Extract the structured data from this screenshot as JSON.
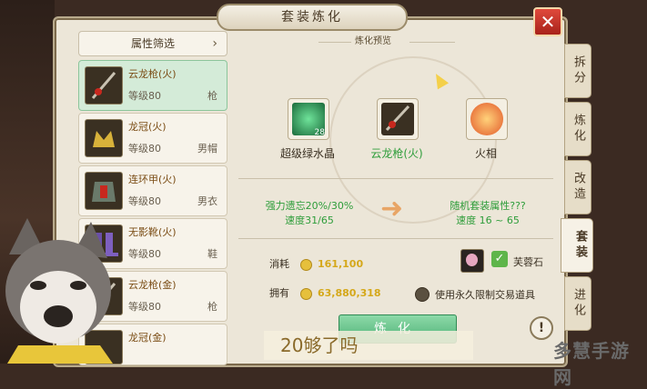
{
  "window": {
    "title": "套装炼化",
    "close_label": "✕"
  },
  "filter": {
    "label": "属性筛选",
    "chevron": "›"
  },
  "items": [
    {
      "name": "云龙枪(火)",
      "level": "等级80",
      "type": "枪",
      "selected": true
    },
    {
      "name": "龙冠(火)",
      "level": "等级80",
      "type": "男帽",
      "selected": false
    },
    {
      "name": "连环甲(火)",
      "level": "等级80",
      "type": "男衣",
      "selected": false
    },
    {
      "name": "无影靴(火)",
      "level": "等级80",
      "type": "鞋",
      "selected": false
    },
    {
      "name": "云龙枪(金)",
      "level": "等级80",
      "type": "枪",
      "selected": false
    },
    {
      "name": "龙冠(金)",
      "level": "",
      "type": "",
      "selected": false
    }
  ],
  "tabs": [
    {
      "label": "拆分",
      "active": false
    },
    {
      "label": "炼化",
      "active": false
    },
    {
      "label": "改造",
      "active": false
    },
    {
      "label": "套装",
      "active": true
    },
    {
      "label": "进化",
      "active": false
    }
  ],
  "preview": {
    "label": "炼化预览",
    "slots": [
      {
        "label": "超级绿水晶",
        "count": "28",
        "color": "#2a5"
      },
      {
        "label": "云龙枪(火)",
        "count": "",
        "color": "#2e9d3a"
      },
      {
        "label": "火相",
        "count": "",
        "color": "#3a3022"
      }
    ]
  },
  "stats": {
    "left_line1": "强力遗忘20%/30%",
    "left_line2": "速度31/65",
    "right_line1": "随机套装属性???",
    "right_line2": "速度 16 ~ 65"
  },
  "cost": {
    "consume_label": "消耗",
    "consume_value": "161,100",
    "own_label": "拥有",
    "own_value": "63,880,318",
    "material_label": "芙蓉石",
    "use_bound_label": "使用永久限制交易道具"
  },
  "actions": {
    "refine_label": "炼化",
    "info_label": "!"
  },
  "overlay": {
    "text": "20够了吗"
  },
  "watermark": {
    "text": "多慧手游网"
  },
  "colors": {
    "accent_green": "#2e9d3a",
    "gold": "#d5a81a",
    "close_red": "#c8281e"
  }
}
